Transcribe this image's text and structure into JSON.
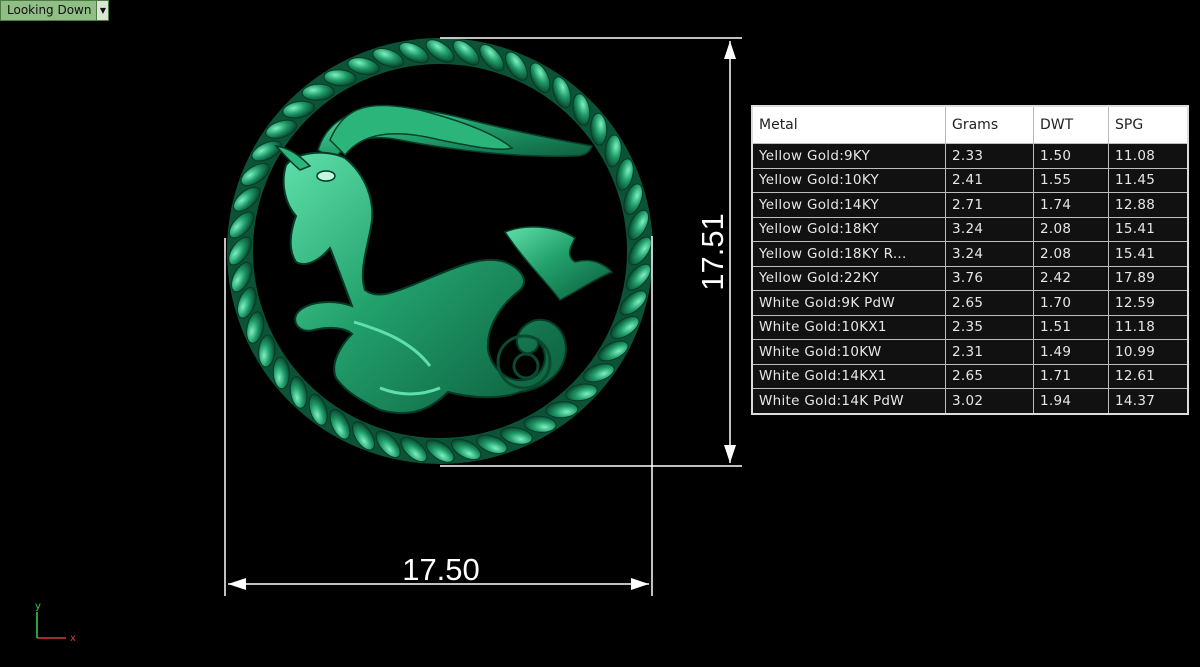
{
  "viewport": {
    "name": "Looking Down"
  },
  "dimensions": {
    "width_label": "17.50",
    "height_label": "17.51"
  },
  "axes": {
    "x_label": "x",
    "y_label": "y"
  },
  "metal_table": {
    "headers": [
      "Metal",
      "Grams",
      "DWT",
      "SPG"
    ],
    "rows": [
      [
        "Yellow Gold:9KY",
        "2.33",
        "1.50",
        "11.08"
      ],
      [
        "Yellow Gold:10KY",
        "2.41",
        "1.55",
        "11.45"
      ],
      [
        "Yellow Gold:14KY",
        "2.71",
        "1.74",
        "12.88"
      ],
      [
        "Yellow Gold:18KY",
        "3.24",
        "2.08",
        "15.41"
      ],
      [
        "Yellow Gold:18KY R...",
        "3.24",
        "2.08",
        "15.41"
      ],
      [
        "Yellow Gold:22KY",
        "3.76",
        "2.42",
        "17.89"
      ],
      [
        "White Gold:9K PdW",
        "2.65",
        "1.70",
        "12.59"
      ],
      [
        "White Gold:10KX1",
        "2.35",
        "1.51",
        "11.18"
      ],
      [
        "White Gold:10KW",
        "2.31",
        "1.49",
        "10.99"
      ],
      [
        "White Gold:14KX1",
        "2.65",
        "1.71",
        "12.61"
      ],
      [
        "White Gold:14K PdW",
        "3.02",
        "1.94",
        "14.37"
      ]
    ]
  },
  "colors": {
    "model": "#1f9a68",
    "model_dark": "#0c5a3b",
    "model_light": "#6fe0b0",
    "dimension_lines": "#ffffff"
  }
}
